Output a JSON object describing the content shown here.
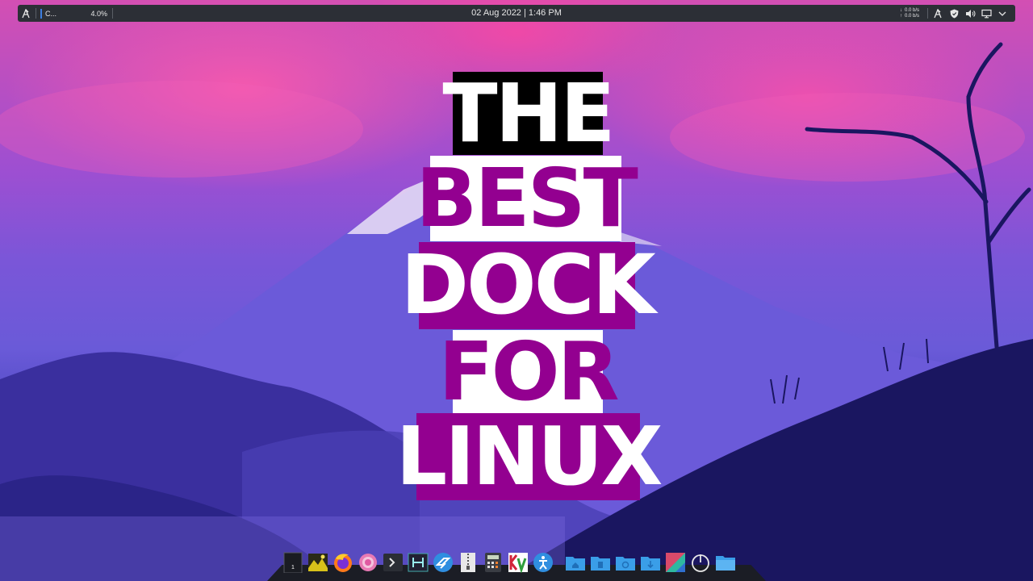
{
  "top_panel": {
    "task_label": "C...",
    "cpu_usage": "4.0%",
    "clock": "02 Aug 2022 | 1:46 PM",
    "net_down": "0.0 b/s",
    "net_up": "0.0 b/s",
    "net_down_arrow": "↓",
    "net_up_arrow": "↑",
    "tray_icons": [
      "app-menu-icon",
      "shield-icon",
      "volume-icon",
      "display-icon",
      "chevron-down-icon"
    ]
  },
  "title": {
    "line1": "THE",
    "line2": "BEST",
    "line3": "DOCK",
    "line4": "FOR",
    "line5": "LINUX"
  },
  "colors": {
    "accent_purple": "#930090",
    "panel_bg": "#2c2f36",
    "dock_bg": "#1b1d25"
  },
  "dock": {
    "workspace_number": "1",
    "items": [
      "workspace-switcher",
      "image-viewer-icon",
      "firefox-icon",
      "pink-app-icon",
      "terminal-icon",
      "system-monitor-icon",
      "kde-connect-icon",
      "archive-manager-icon",
      "calculator-icon",
      "kvantum-manager-icon",
      "accessibility-icon",
      "home-folder-icon",
      "documents-folder-icon",
      "music-folder-icon",
      "downloads-folder-icon",
      "kde-settings-icon",
      "power-icon",
      "file-manager-icon"
    ]
  }
}
